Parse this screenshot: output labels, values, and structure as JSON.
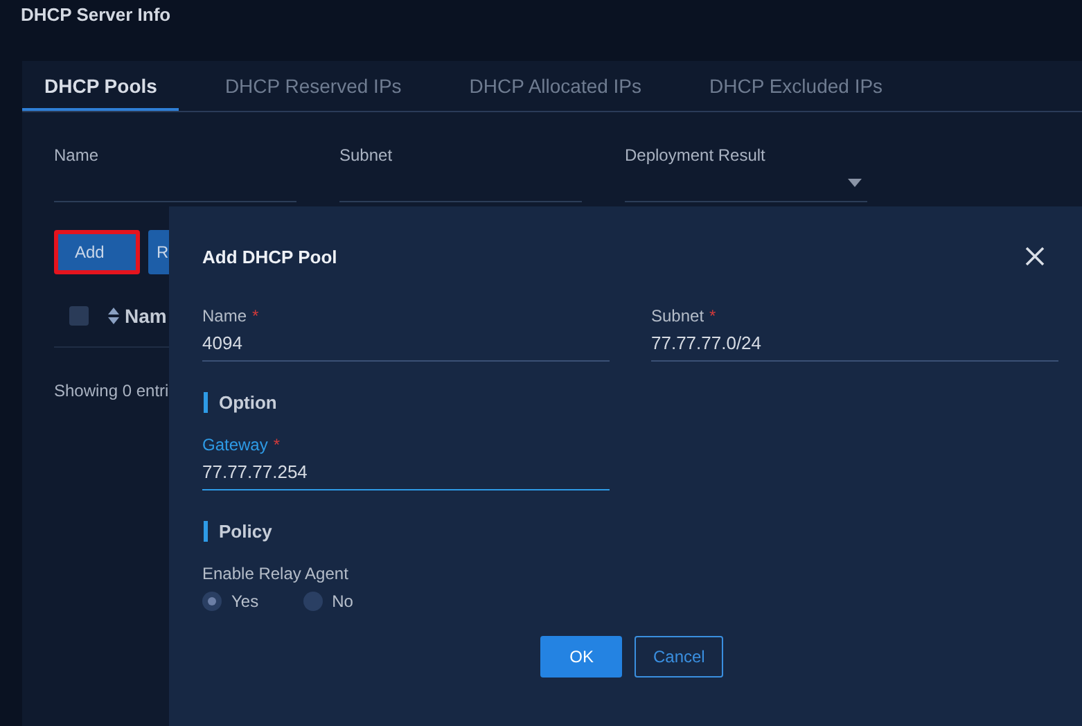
{
  "page_title": "DHCP Server Info",
  "tabs": [
    {
      "label": "DHCP Pools",
      "selected": true
    },
    {
      "label": "DHCP Reserved IPs",
      "selected": false
    },
    {
      "label": "DHCP Allocated IPs",
      "selected": false
    },
    {
      "label": "DHCP Excluded IPs",
      "selected": false
    }
  ],
  "filters": [
    {
      "label": "Name",
      "kind": "text"
    },
    {
      "label": "Subnet",
      "kind": "text"
    },
    {
      "label": "Deployment Result",
      "kind": "select"
    }
  ],
  "actions": [
    {
      "label": "Add",
      "highlighted": true
    },
    {
      "label": "R",
      "highlighted": false
    }
  ],
  "table": {
    "select_all_checked": false,
    "columns": [
      "Nam"
    ]
  },
  "footer": "Showing 0 entri",
  "dialog": {
    "title": "Add DHCP Pool",
    "fields": [
      {
        "label": "Name",
        "required_mark": "*",
        "value": "4094",
        "focused": false
      },
      {
        "label": "Subnet",
        "required_mark": "*",
        "value": "77.77.77.0/24",
        "focused": false
      }
    ],
    "sections": [
      {
        "title": "Option",
        "fields": [
          {
            "label": "Gateway",
            "required_mark": "*",
            "value": "77.77.77.254",
            "focused": true
          }
        ]
      },
      {
        "title": "Policy",
        "radio_group": {
          "label": "Enable Relay Agent",
          "options": [
            {
              "label": "Yes",
              "selected": true
            },
            {
              "label": "No",
              "selected": false
            }
          ]
        }
      }
    ],
    "buttons": [
      {
        "label": "OK",
        "kind": "primary"
      },
      {
        "label": "Cancel",
        "kind": "secondary"
      }
    ]
  }
}
